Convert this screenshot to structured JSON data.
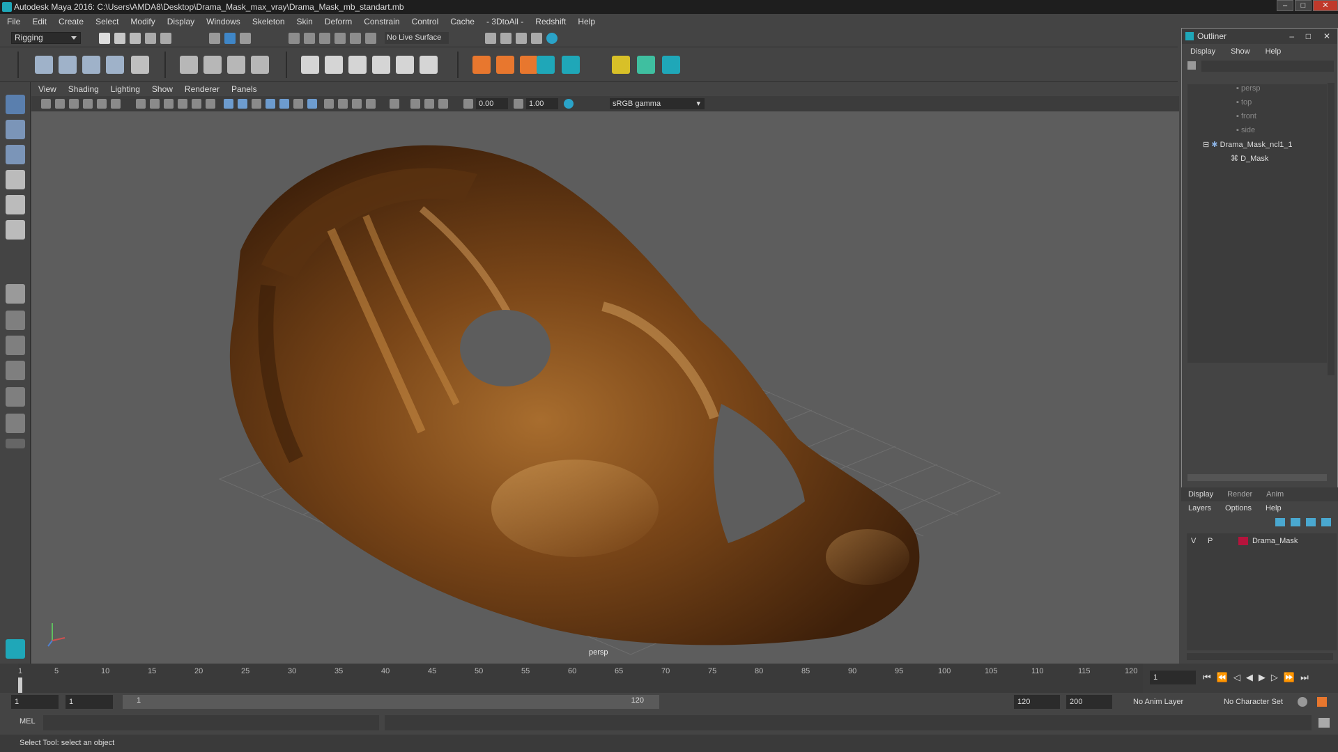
{
  "window": {
    "title": "Autodesk Maya 2016: C:\\Users\\AMDA8\\Desktop\\Drama_Mask_max_vray\\Drama_Mask_mb_standart.mb"
  },
  "menubar": [
    "File",
    "Edit",
    "Create",
    "Select",
    "Modify",
    "Display",
    "Windows",
    "Skeleton",
    "Skin",
    "Deform",
    "Constrain",
    "Control",
    "Cache",
    "- 3DtoAll -",
    "Redshift",
    "Help"
  ],
  "statusline": {
    "mode": "Rigging",
    "live_surface": "No Live Surface"
  },
  "panel_menu": [
    "View",
    "Shading",
    "Lighting",
    "Show",
    "Renderer",
    "Panels"
  ],
  "panel_toolbar": {
    "exposure": "0.00",
    "gamma_value": "1.00",
    "color_space": "sRGB gamma"
  },
  "viewport": {
    "camera_label": "persp"
  },
  "outliner": {
    "title": "Outliner",
    "menu": [
      "Display",
      "Show",
      "Help"
    ],
    "items": [
      {
        "label": "persp"
      },
      {
        "label": "top"
      },
      {
        "label": "front"
      },
      {
        "label": "side"
      },
      {
        "label": "Drama_Mask_ncl1_1"
      },
      {
        "label": "D_Mask"
      }
    ]
  },
  "layers": {
    "tabs": [
      "Display",
      "Render",
      "Anim"
    ],
    "menu": [
      "Layers",
      "Options",
      "Help"
    ],
    "layer": {
      "v": "V",
      "p": "P",
      "name": "Drama_Mask",
      "color": "#b5143c"
    }
  },
  "timeline": {
    "ticks": [
      "1",
      "5",
      "10",
      "15",
      "20",
      "25",
      "30",
      "35",
      "40",
      "45",
      "50",
      "55",
      "60",
      "65",
      "70",
      "75",
      "80",
      "85",
      "90",
      "95",
      "100",
      "105",
      "110",
      "115",
      "120"
    ],
    "current_frame": "1"
  },
  "range": {
    "start": "1",
    "playback_start": "1",
    "slider_start": "1",
    "slider_end": "120",
    "playback_end": "120",
    "end": "200",
    "anim_layer": "No Anim Layer",
    "character_set": "No Character Set"
  },
  "command": {
    "language": "MEL"
  },
  "help_line": "Select Tool: select an object"
}
